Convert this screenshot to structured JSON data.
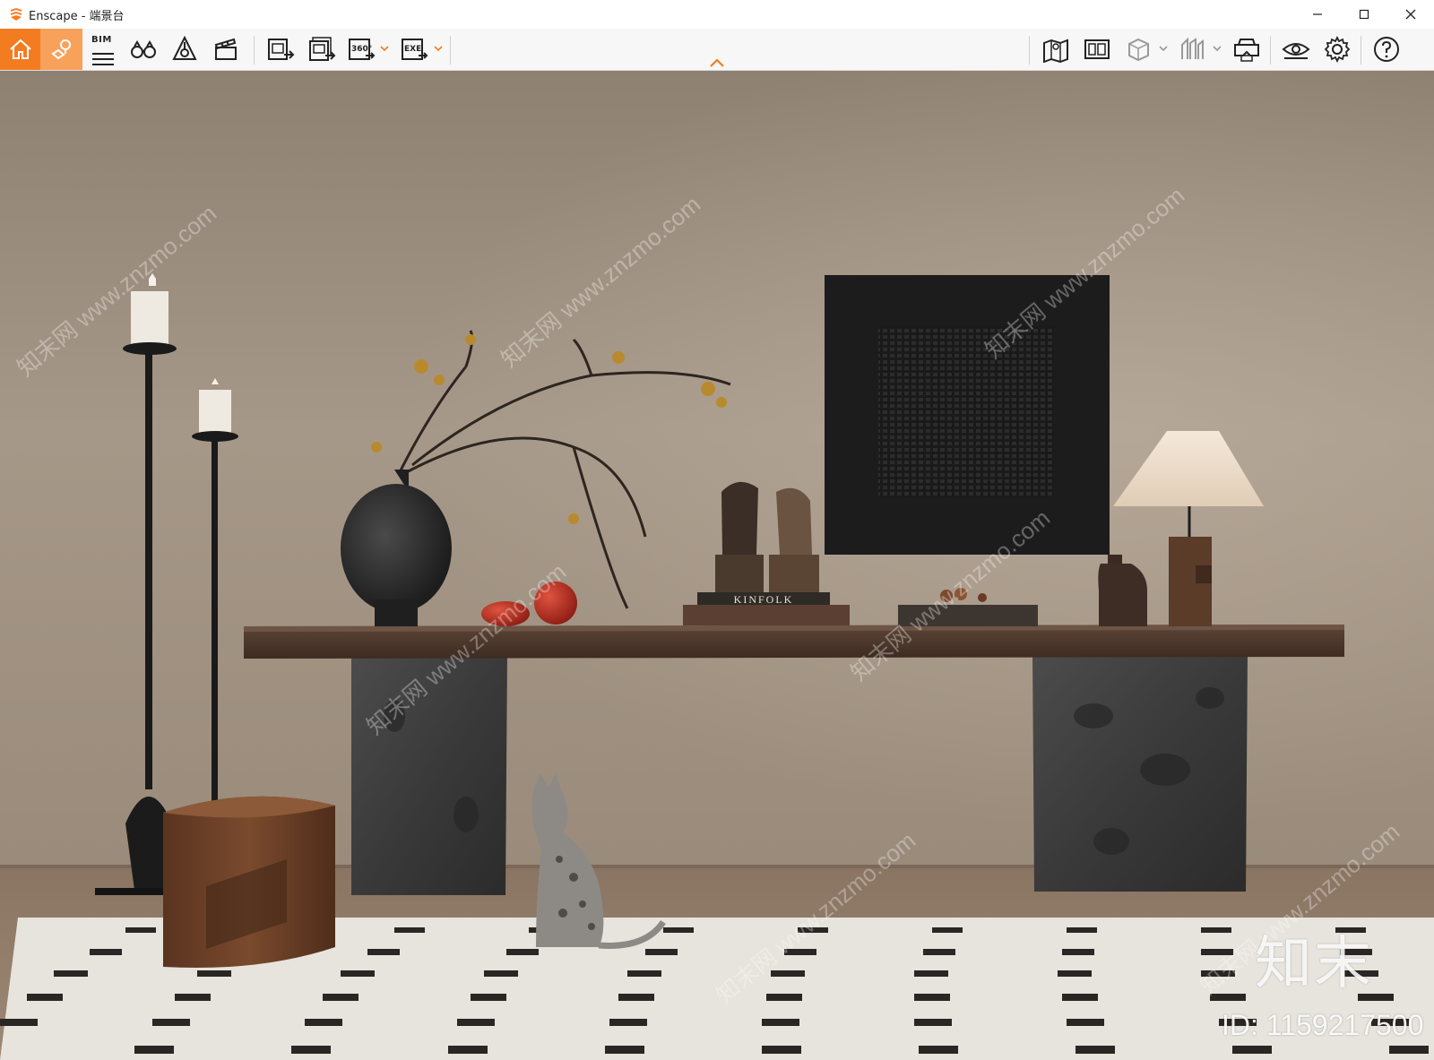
{
  "window": {
    "app_name": "Enscape",
    "title": "Enscape - 端景台",
    "controls": {
      "minimize": "minimize-icon",
      "maximize": "maximize-icon",
      "close": "close-icon"
    }
  },
  "toolbar": {
    "left_buttons": [
      {
        "id": "home",
        "icon": "home-icon",
        "state": "active"
      },
      {
        "id": "view-management",
        "icon": "pin-map-icon",
        "state": "active"
      },
      {
        "id": "bim",
        "icon": "bim-icon",
        "label": "BIM"
      },
      {
        "id": "binoculars",
        "icon": "binoculars-icon"
      },
      {
        "id": "assets",
        "icon": "asset-library-icon"
      },
      {
        "id": "video-editor",
        "icon": "clapperboard-icon"
      },
      {
        "id": "screenshot-export",
        "icon": "image-export-icon"
      },
      {
        "id": "batch-export",
        "icon": "batch-image-export-icon"
      },
      {
        "id": "panorama-export",
        "icon": "panorama-360-icon",
        "label": "360°",
        "has_dropdown": true
      },
      {
        "id": "exe-export",
        "icon": "exe-export-icon",
        "label": "EXE",
        "has_dropdown": true
      }
    ],
    "right_buttons": [
      {
        "id": "map",
        "icon": "map-pin-icon"
      },
      {
        "id": "image-view",
        "icon": "image-gallery-icon"
      },
      {
        "id": "cube-view",
        "icon": "cube-icon",
        "has_dropdown": true
      },
      {
        "id": "collaborative",
        "icon": "collaboration-icon",
        "has_dropdown": true
      },
      {
        "id": "vr-headset",
        "icon": "vr-headset-icon"
      },
      {
        "id": "visual-settings",
        "icon": "eye-icon"
      },
      {
        "id": "settings",
        "icon": "gear-icon"
      },
      {
        "id": "help",
        "icon": "help-icon"
      }
    ],
    "collapse_toggle": "chevron-up-icon"
  },
  "colors": {
    "accent": "#f47c20",
    "accent_light": "#f8a15a",
    "wall": "#a39585",
    "floor": "#8f7a66",
    "rug": "#eae6e0",
    "tabletop": "#4f3a2d",
    "stone": "#3d3d3d",
    "artwork": "#1c1c1c"
  },
  "viewport": {
    "book_spine_text": "KINFOLK",
    "watermark_text": "知末网 www.znzmo.com",
    "brand_mark": "知末",
    "image_id": "ID: 1159217500"
  }
}
